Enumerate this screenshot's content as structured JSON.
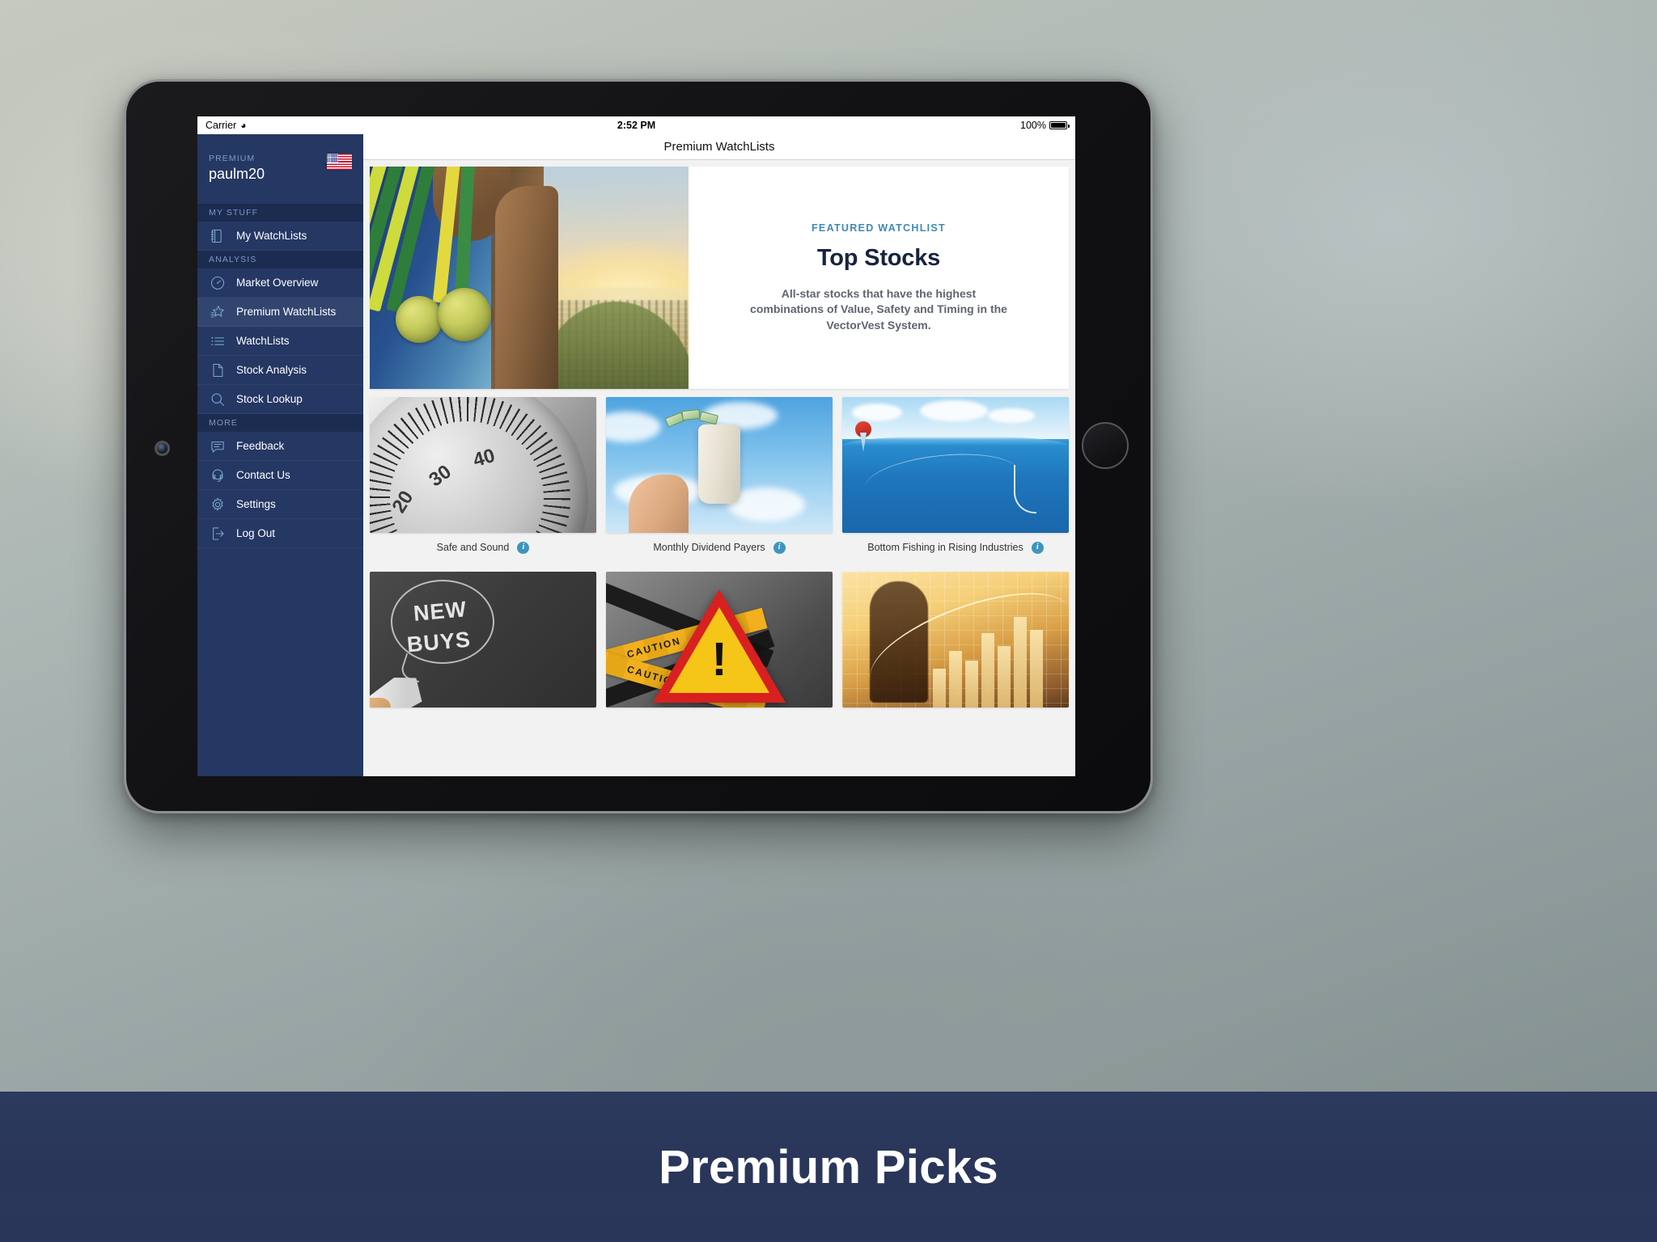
{
  "caption": {
    "text": "Premium Picks"
  },
  "status_bar": {
    "carrier": "Carrier",
    "wifi_icon": "wifi-icon",
    "time": "2:52 PM",
    "battery_percent": "100%",
    "battery_icon": "battery-full-icon"
  },
  "nav_bar": {
    "title": "Premium WatchLists"
  },
  "sidebar": {
    "account": {
      "tier": "PREMIUM",
      "username": "paulm20",
      "flag_icon": "us-flag-icon"
    },
    "sections": [
      {
        "header": "MY STUFF",
        "items": [
          {
            "label": "My WatchLists",
            "icon": "notebook-icon",
            "active": false
          }
        ]
      },
      {
        "header": "ANALYSIS",
        "items": [
          {
            "label": "Market Overview",
            "icon": "gauge-icon",
            "active": false
          },
          {
            "label": "Premium WatchLists",
            "icon": "star-list-icon",
            "active": true
          },
          {
            "label": "WatchLists",
            "icon": "bullet-list-icon",
            "active": false
          },
          {
            "label": "Stock Analysis",
            "icon": "document-icon",
            "active": false
          },
          {
            "label": "Stock Lookup",
            "icon": "search-icon",
            "active": false
          }
        ]
      },
      {
        "header": "MORE",
        "items": [
          {
            "label": "Feedback",
            "icon": "chat-bubble-icon",
            "active": false
          },
          {
            "label": "Contact Us",
            "icon": "headset-agent-icon",
            "active": false
          },
          {
            "label": "Settings",
            "icon": "gear-icon",
            "active": false
          },
          {
            "label": "Log Out",
            "icon": "logout-icon",
            "active": false
          }
        ]
      }
    ]
  },
  "featured": {
    "kicker": "FEATURED WATCHLIST",
    "title": "Top Stocks",
    "description": "All-star stocks that have the highest combinations of Value, Safety and Timing in the VectorVest System.",
    "image_alt": "athlete-with-gold-medals-photo"
  },
  "cards": [
    {
      "label": "Safe and Sound",
      "info_icon": "info-icon",
      "image_alt": "safe-dial-photo",
      "art": "art-safe"
    },
    {
      "label": "Monthly Dividend Payers",
      "info_icon": "info-icon",
      "image_alt": "money-bag-on-hand-photo",
      "art": "art-money"
    },
    {
      "label": "Bottom Fishing in Rising Industries",
      "info_icon": "info-icon",
      "image_alt": "fishing-hook-underwater-photo",
      "art": "art-fish"
    },
    {
      "label": "",
      "info_icon": "",
      "image_alt": "new-buys-chalkboard-photo",
      "art": "art-new"
    },
    {
      "label": "",
      "info_icon": "",
      "image_alt": "caution-warning-sign-photo",
      "art": "art-caution"
    },
    {
      "label": "",
      "info_icon": "",
      "image_alt": "businessman-rising-chart-photo",
      "art": "art-gold"
    }
  ],
  "colors": {
    "sidebar_bg": "#253763",
    "sidebar_section_bg": "#1c2c51",
    "sidebar_active_bg": "#32456f",
    "sidebar_icon": "#79aacd",
    "accent_blue": "#3e8ab5",
    "info_badge": "#3d95be",
    "caption_band": "#2a3659",
    "featured_title": "#17233f"
  },
  "artwork": {
    "safe_dial_numbers": [
      "20",
      "30",
      "40"
    ],
    "new_buys_lines": [
      "NEW",
      "BUYS"
    ],
    "caution_word": "CAUTION"
  }
}
